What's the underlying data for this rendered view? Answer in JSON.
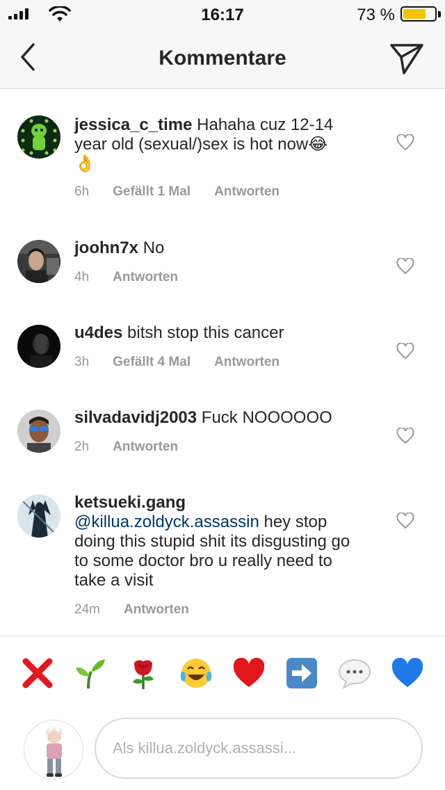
{
  "status_bar": {
    "time": "16:17",
    "battery_text": "73 %",
    "battery_level": 0.73,
    "battery_color": "#f5c400"
  },
  "nav": {
    "title": "Kommentare",
    "back_icon": "chevron-left-icon",
    "send_icon": "paper-plane-icon"
  },
  "comments": [
    {
      "username": "jessica_c_time",
      "text": "Hahaha cuz 12-14 year old (sexual/)sex is hot now😂 👌",
      "time": "6h",
      "likes": "Gefällt 1 Mal",
      "reply": "Antworten"
    },
    {
      "username": "joohn7x",
      "text": "No",
      "time": "4h",
      "likes": "",
      "reply": "Antworten"
    },
    {
      "username": "u4des",
      "text": "bitsh stop this cancer",
      "time": "3h",
      "likes": "Gefällt 4 Mal",
      "reply": "Antworten"
    },
    {
      "username": "silvadavidj2003",
      "text": "Fuck NOOOOOO",
      "time": "2h",
      "likes": "",
      "reply": "Antworten"
    },
    {
      "username": "ketsueki.gang",
      "mention": "@killua.zoldyck.assassin",
      "text": "hey stop doing this stupid shit its disgusting go to some doctor bro u really need to take a visit",
      "time": "24m",
      "likes": "",
      "reply": "Antworten"
    }
  ],
  "emoji_bar": [
    "❌",
    "🌱",
    "🌹",
    "😂",
    "❤️",
    "➡️",
    "💬",
    "💙"
  ],
  "input": {
    "placeholder": "Als killua.zoldyck.assassi..."
  },
  "colors": {
    "mention": "#003569",
    "meta": "#999999",
    "border": "#dbdbdb"
  }
}
